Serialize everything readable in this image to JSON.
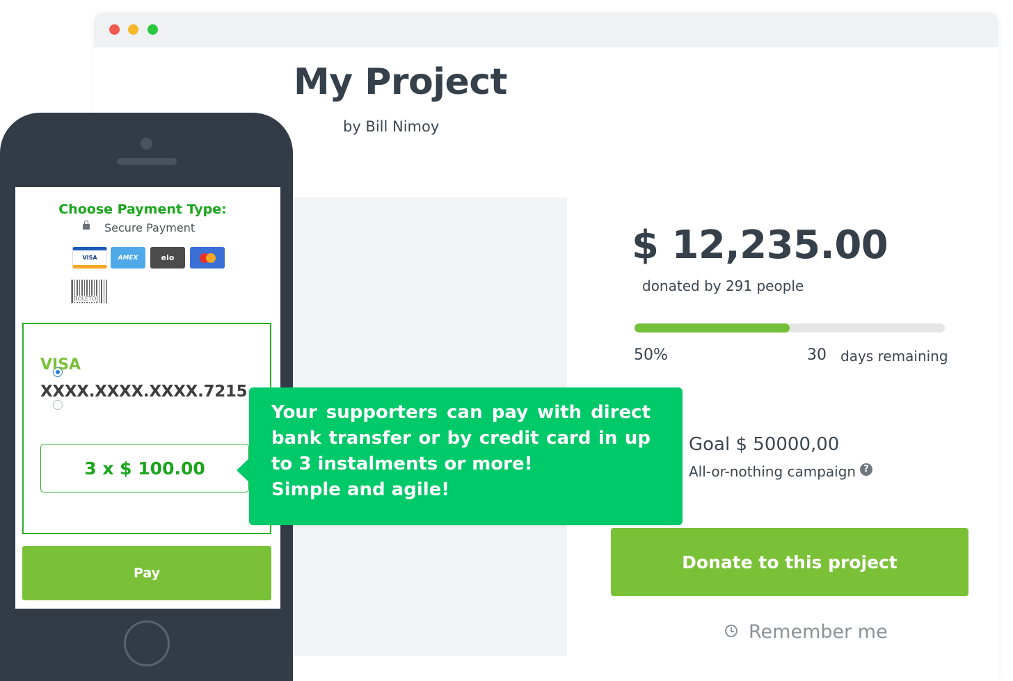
{
  "project": {
    "title": "My Project",
    "author": "by Bill Nimoy"
  },
  "funding": {
    "amount": "$ 12,235.00",
    "donors": "donated by 291 people",
    "progress_fraction": 0.5,
    "percent_label": "50%",
    "days_number": "30",
    "days_label": "days remaining",
    "goal": "Goal $ 50000,00",
    "campaign_type": "All-or-nothing campaign",
    "help_icon_glyph": "?"
  },
  "actions": {
    "donate_label": "Donate to this project",
    "remember_label": "Remember me"
  },
  "phone": {
    "payment_title": "Choose Payment Type:",
    "secure_label": "Secure Payment",
    "card_logos": {
      "visa": "VISA",
      "amex": "AMEX",
      "elo": "elo"
    },
    "boleto_label": "BOLETO",
    "card_brand": "VISA",
    "card_number": "XXXX.XXXX.XXXX.7215",
    "instalments": "3 x $ 100.00",
    "pay_label": "Pay"
  },
  "callout": {
    "line1": "Your supporters can pay with direct bank transfer or by credit card in up to 3 instalments or more!",
    "line2": "Simple and agile!"
  },
  "colors": {
    "accent_green": "#7ac138",
    "callout_green": "#00c969",
    "title_green": "#1aa51c",
    "phone_body": "#333b47"
  },
  "icons": [
    "lock-icon",
    "help-icon",
    "clock-icon",
    "radio-selected",
    "radio-unselected",
    "boleto-barcode-icon"
  ]
}
